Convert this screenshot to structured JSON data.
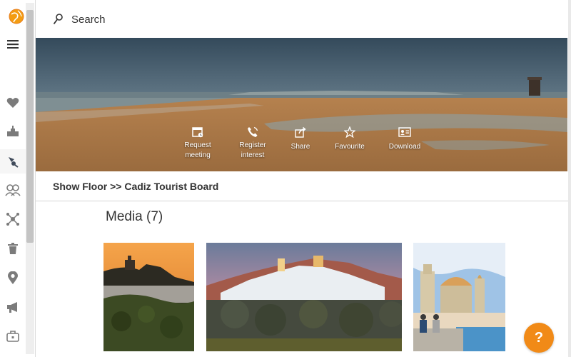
{
  "search": {
    "label": "Search"
  },
  "hero": {
    "actions": [
      {
        "line1": "Request",
        "line2": "meeting",
        "icon": "calendar-icon"
      },
      {
        "line1": "Register",
        "line2": "interest",
        "icon": "phone-icon"
      },
      {
        "line1": "Share",
        "line2": "",
        "icon": "share-icon"
      },
      {
        "line1": "Favourite",
        "line2": "",
        "icon": "star-icon"
      },
      {
        "line1": "Download",
        "line2": "",
        "icon": "contact-card-icon"
      }
    ]
  },
  "breadcrumb": {
    "text": "Show Floor >> Cadiz Tourist Board"
  },
  "media": {
    "title": "Media (7)"
  },
  "help": {
    "label": "?"
  },
  "sidebar": {
    "icons": [
      "globe-logo-icon",
      "menu-icon",
      "heart-icon",
      "stand-icon",
      "exhibitor-icon",
      "networking-icon",
      "connections-icon",
      "bin-icon",
      "location-pin-icon",
      "megaphone-icon",
      "briefcase-icon"
    ]
  },
  "colors": {
    "accent": "#f18a17",
    "sidebar_icon": "#7b7b7b",
    "active_icon": "#3f4a5a"
  }
}
